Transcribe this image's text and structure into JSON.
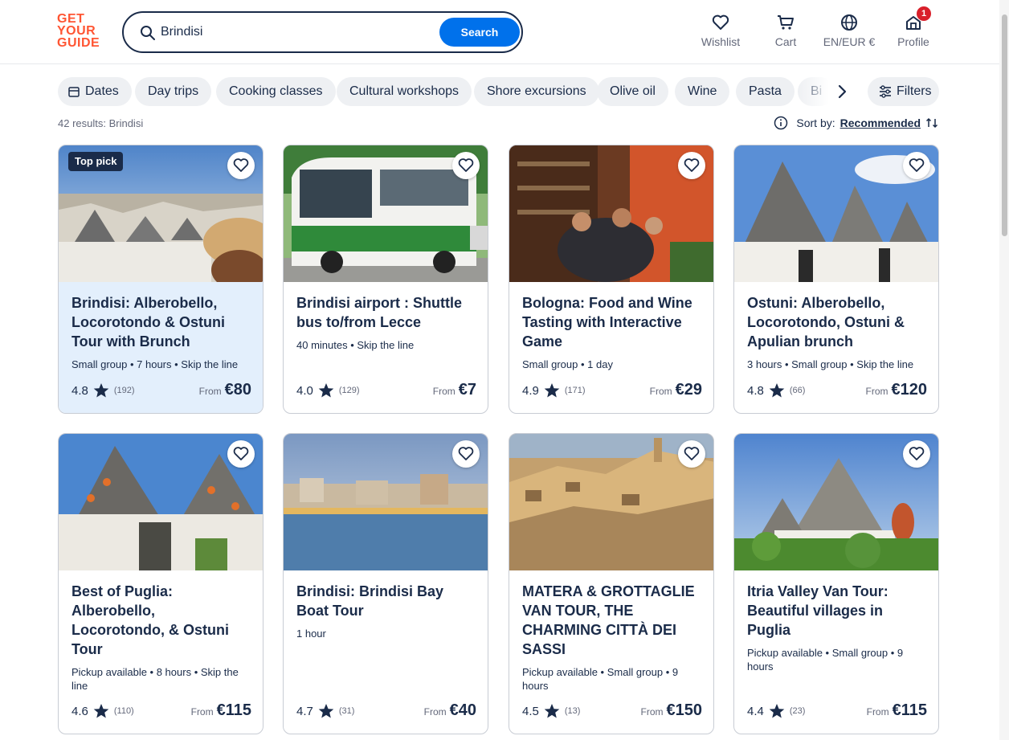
{
  "logo": {
    "line1": "GET",
    "line2": "YOUR",
    "line3": "GUIDE"
  },
  "search": {
    "value": "Brindisi",
    "button": "Search"
  },
  "nav": {
    "wishlist": "Wishlist",
    "cart": "Cart",
    "language": "EN/EUR €",
    "profile": "Profile",
    "profile_badge": "1"
  },
  "chips": [
    "Dates",
    "Day trips",
    "Cooking classes",
    "Cultural workshops",
    "Shore excursions",
    "Olive oil",
    "Wine",
    "Pasta",
    "Bi"
  ],
  "filters_label": "Filters",
  "results_text": "42 results: Brindisi",
  "sort": {
    "label": "Sort by:",
    "value": "Recommended"
  },
  "colors": {
    "brand": "#ff5533",
    "primary": "#0071eb",
    "text": "#1a2b49",
    "highlight": "#e3effc"
  },
  "cards": [
    {
      "title": "Brindisi: Alberobello, Locorotondo & Ostuni Tour with Brunch",
      "meta": "Small group • 7 hours • Skip the line",
      "rating": "4.8",
      "reviews": "(192)",
      "from": "From",
      "price": "€80",
      "badge": "Top pick"
    },
    {
      "title": "Brindisi airport : Shuttle bus to/from Lecce",
      "meta": "40 minutes • Skip the line",
      "rating": "4.0",
      "reviews": "(129)",
      "from": "From",
      "price": "€7"
    },
    {
      "title": "Bologna: Food and Wine Tasting with Interactive Game",
      "meta": "Small group • 1 day",
      "rating": "4.9",
      "reviews": "(171)",
      "from": "From",
      "price": "€29"
    },
    {
      "title": "Ostuni: Alberobello, Locorotondo, Ostuni & Apulian brunch",
      "meta": "3 hours • Small group • Skip the line",
      "rating": "4.8",
      "reviews": "(66)",
      "from": "From",
      "price": "€120"
    },
    {
      "title": "Best of Puglia: Alberobello, Locorotondo, & Ostuni Tour",
      "meta": "Pickup available • 8 hours • Skip the line",
      "rating": "4.6",
      "reviews": "(110)",
      "from": "From",
      "price": "€115"
    },
    {
      "title": "Brindisi: Brindisi Bay Boat Tour",
      "meta": "1 hour",
      "rating": "4.7",
      "reviews": "(31)",
      "from": "From",
      "price": "€40"
    },
    {
      "title": "MATERA & GROTTAGLIE VAN TOUR, THE CHARMING CITTÀ DEI SASSI",
      "meta": "Pickup available • Small group • 9 hours",
      "rating": "4.5",
      "reviews": "(13)",
      "from": "From",
      "price": "€150"
    },
    {
      "title": "Itria Valley Van Tour: Beautiful villages in Puglia",
      "meta": "Pickup available • Small group • 9 hours",
      "rating": "4.4",
      "reviews": "(23)",
      "from": "From",
      "price": "€115"
    }
  ]
}
